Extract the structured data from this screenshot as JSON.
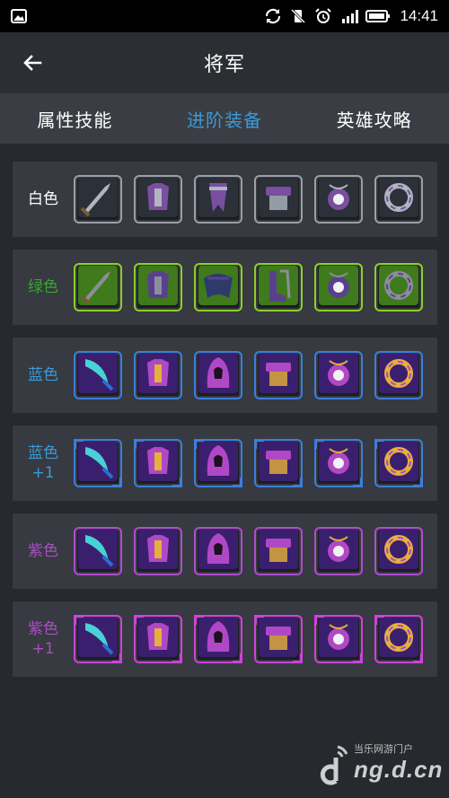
{
  "status_bar": {
    "time": "14:41",
    "icons": [
      "image-icon",
      "sync-icon",
      "vibrate-off-icon",
      "alarm-icon",
      "signal-icon",
      "battery-icon"
    ]
  },
  "header": {
    "title": "将军",
    "back_icon": "back-arrow-icon"
  },
  "tabs": [
    {
      "label": "属性技能",
      "active": false
    },
    {
      "label": "进阶装备",
      "active": true
    },
    {
      "label": "英雄攻略",
      "active": false
    }
  ],
  "colors": {
    "white": "#ffffff",
    "green": "#3aa52f",
    "blue": "#3a9ad9",
    "purple": "#a84fc2",
    "tab_active": "#3a9ad9"
  },
  "tiers": [
    {
      "label": "白色",
      "color": "#ffffff",
      "border": "#9aa0a6",
      "items": [
        "sword-icon",
        "armor-icon",
        "sash-icon",
        "belt-icon",
        "amulet-icon",
        "ring-icon"
      ]
    },
    {
      "label": "绿色",
      "color": "#3aa52f",
      "border": "#8ccf2b",
      "items": [
        "sword-icon",
        "armor-icon",
        "cloak-icon",
        "boots-icon",
        "amulet-icon",
        "ring-icon"
      ]
    },
    {
      "label": "蓝色",
      "color": "#3a9ad9",
      "border": "#3a7ee0",
      "items": [
        "blade-icon",
        "chestplate-icon",
        "hood-icon",
        "belt-icon",
        "amulet-icon",
        "ring-icon"
      ]
    },
    {
      "label": "蓝色+1",
      "color": "#3a9ad9",
      "border": "#3a7ee0",
      "items": [
        "blade-icon",
        "chestplate-icon",
        "hood-icon",
        "belt-icon",
        "amulet-icon",
        "ring-icon"
      ]
    },
    {
      "label": "紫色",
      "color": "#a84fc2",
      "border": "#b04ad4",
      "items": [
        "blade-icon",
        "chestplate-icon",
        "hood-icon",
        "belt-icon",
        "amulet-icon",
        "ring-icon"
      ]
    },
    {
      "label": "紫色+1",
      "color": "#a84fc2",
      "border": "#d13fe0",
      "items": [
        "blade-icon",
        "chestplate-icon",
        "hood-icon",
        "belt-icon",
        "amulet-icon",
        "ring-icon"
      ]
    }
  ],
  "watermark": {
    "top": "当乐网游门户",
    "main": "ng.d.cn"
  }
}
